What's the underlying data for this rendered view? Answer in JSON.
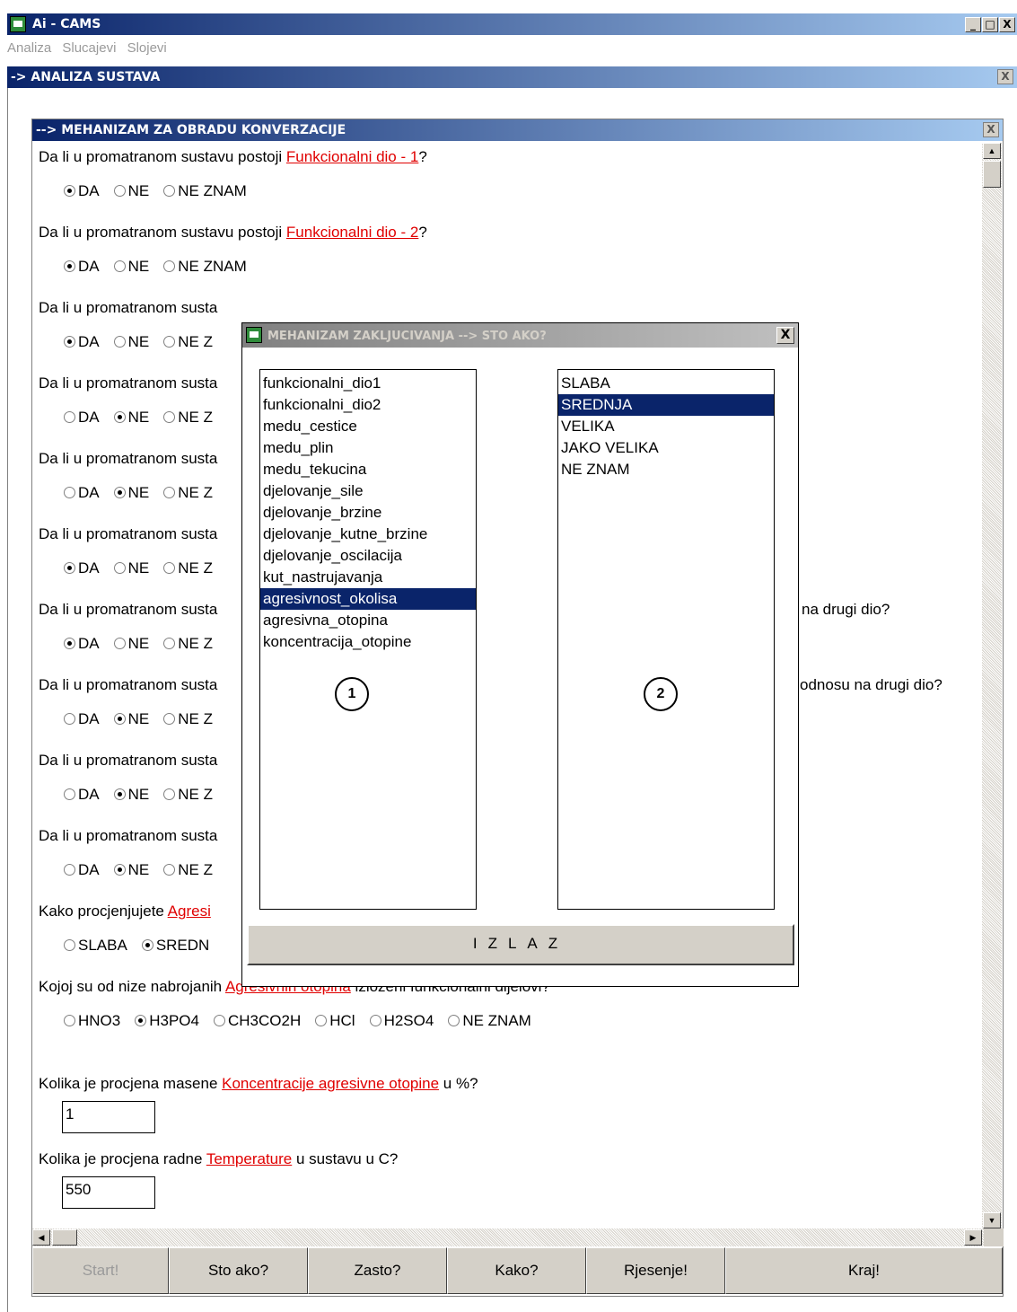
{
  "window": {
    "title": "Ai - CAMS",
    "buttons": [
      "_",
      "□",
      "X"
    ]
  },
  "menu": [
    "Analiza",
    "Slucajevi",
    "Slojevi"
  ],
  "analysis_window": {
    "title": "-> ANALIZA SUSTAVA",
    "close": "X"
  },
  "conversation_window": {
    "title": "--> MEHANIZAM ZA OBRADU KONVERZACIJE",
    "close": "X"
  },
  "questions": [
    {
      "prefix": "Da li u promatranom sustavu postoji ",
      "keyword": "Funkcionalni dio - 1",
      "suffix": "?",
      "options": [
        "DA",
        "NE",
        "NE ZNAM"
      ],
      "selected": 0
    },
    {
      "prefix": "Da li u promatranom sustavu postoji ",
      "keyword": "Funkcionalni dio - 2",
      "suffix": "?",
      "options": [
        "DA",
        "NE",
        "NE ZNAM"
      ],
      "selected": 0
    },
    {
      "prefix": "Da li u promatranom susta",
      "keyword": "",
      "suffix": "",
      "options": [
        "DA",
        "NE",
        "NE Z"
      ],
      "selected": 0
    },
    {
      "prefix": "Da li u promatranom susta",
      "keyword": "",
      "suffix": "",
      "options": [
        "DA",
        "NE",
        "NE Z"
      ],
      "selected": 1
    },
    {
      "prefix": "Da li u promatranom susta",
      "keyword": "",
      "suffix": "",
      "options": [
        "DA",
        "NE",
        "NE Z"
      ],
      "selected": 1
    },
    {
      "prefix": "Da li u promatranom susta",
      "keyword": "",
      "suffix": "",
      "options": [
        "DA",
        "NE",
        "NE Z"
      ],
      "selected": 0
    },
    {
      "prefix": "Da li u promatranom susta",
      "keyword": "",
      "suffix": "",
      "tail": "na drugi dio?",
      "options": [
        "DA",
        "NE",
        "NE Z"
      ],
      "selected": 0
    },
    {
      "prefix": "Da li u promatranom susta",
      "keyword": "",
      "suffix": "",
      "tail": "odnosu na drugi dio?",
      "options": [
        "DA",
        "NE",
        "NE Z"
      ],
      "selected": 1
    },
    {
      "prefix": "Da li u promatranom susta",
      "keyword": "",
      "suffix": "",
      "options": [
        "DA",
        "NE",
        "NE Z"
      ],
      "selected": 1
    },
    {
      "prefix": "Da li u promatranom susta",
      "keyword": "",
      "suffix": "",
      "options": [
        "DA",
        "NE",
        "NE Z"
      ],
      "selected": 1
    },
    {
      "prefix": "Kako procjenjujete ",
      "keyword": "Agresi",
      "suffix": "",
      "options": [
        "SLABA",
        "SREDN"
      ],
      "selected": 1
    },
    {
      "prefix": "Kojoj su od nize nabrojanih ",
      "keyword": "Agresivnih otopina",
      "suffix": " izlozeni funkcionalni dijelovi?",
      "options": [
        "HNO3",
        "H3PO4",
        "CH3CO2H",
        "HCl",
        "H2SO4",
        "NE ZNAM"
      ],
      "selected": 1
    }
  ],
  "q_concentration": {
    "prefix": "Kolika je procjena masene ",
    "keyword": "Koncentracije agresivne otopine",
    "suffix": " u %?",
    "value": "1"
  },
  "q_temperature": {
    "prefix": "Kolika je procjena radne ",
    "keyword": "Temperature",
    "suffix": " u sustavu u C?",
    "value": "550"
  },
  "bottom_buttons": [
    "Start!",
    "Sto ako?",
    "Zasto?",
    "Kako?",
    "Rjesenje!",
    "Kraj!"
  ],
  "dialog": {
    "title": "MEHANIZAM ZAKLJUCIVANJA --> STO AKO?",
    "close": "X",
    "list1": [
      "funkcionalni_dio1",
      "funkcionalni_dio2",
      "medu_cestice",
      "medu_plin",
      "medu_tekucina",
      "djelovanje_sile",
      "djelovanje_brzine",
      "djelovanje_kutne_brzine",
      "djelovanje_oscilacija",
      "kut_nastrujavanja",
      "agresivnost_okolisa",
      "agresivna_otopina",
      "koncentracija_otopine"
    ],
    "list1_selected": 10,
    "list2": [
      "SLABA",
      "SREDNJA",
      "VELIKA",
      "JAKO VELIKA",
      "NE ZNAM"
    ],
    "list2_selected": 1,
    "marker1": "1",
    "marker2": "2",
    "exit_label": "IZLAZ"
  },
  "colors": {
    "title_bar": "#0a246a",
    "link": "#e00000",
    "selection": "#0a246a",
    "face": "#d4d0c8"
  }
}
